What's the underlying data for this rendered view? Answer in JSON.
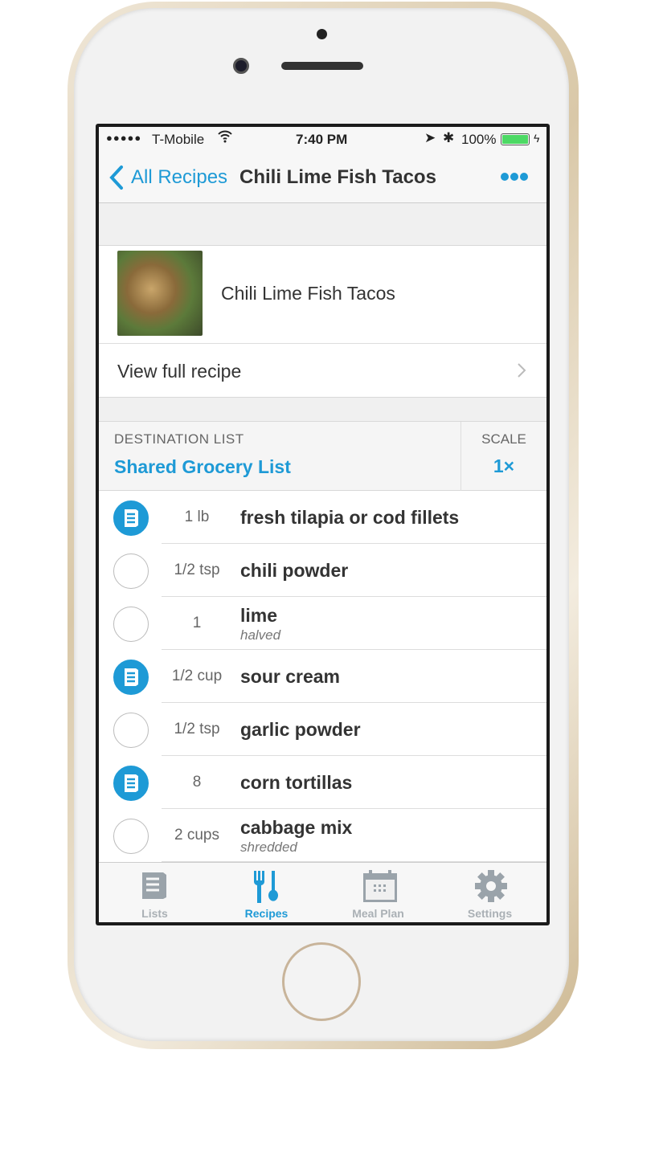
{
  "status_bar": {
    "carrier": "T-Mobile",
    "time": "7:40 PM",
    "battery": "100%"
  },
  "nav": {
    "back_label": "All Recipes",
    "title": "Chili Lime Fish Tacos"
  },
  "recipe": {
    "name": "Chili Lime Fish Tacos",
    "view_full": "View full recipe"
  },
  "destination": {
    "label": "DESTINATION LIST",
    "value": "Shared Grocery List",
    "scale_label": "SCALE",
    "scale_value": "1×"
  },
  "ingredients": [
    {
      "qty": "1 lb",
      "name": "fresh tilapia or cod fillets",
      "note": "",
      "on_list": true
    },
    {
      "qty": "1/2 tsp",
      "name": "chili powder",
      "note": "",
      "on_list": false
    },
    {
      "qty": "1",
      "name": "lime",
      "note": "halved",
      "on_list": false
    },
    {
      "qty": "1/2 cup",
      "name": "sour cream",
      "note": "",
      "on_list": true
    },
    {
      "qty": "1/2 tsp",
      "name": "garlic powder",
      "note": "",
      "on_list": false
    },
    {
      "qty": "8",
      "name": "corn tortillas",
      "note": "",
      "on_list": true
    },
    {
      "qty": "2 cups",
      "name": "cabbage mix",
      "note": "shredded",
      "on_list": false
    }
  ],
  "tabs": [
    {
      "label": "Lists"
    },
    {
      "label": "Recipes",
      "active": true
    },
    {
      "label": "Meal Plan"
    },
    {
      "label": "Settings"
    }
  ],
  "colors": {
    "accent": "#1e9ad6",
    "battery": "#4cd964"
  }
}
